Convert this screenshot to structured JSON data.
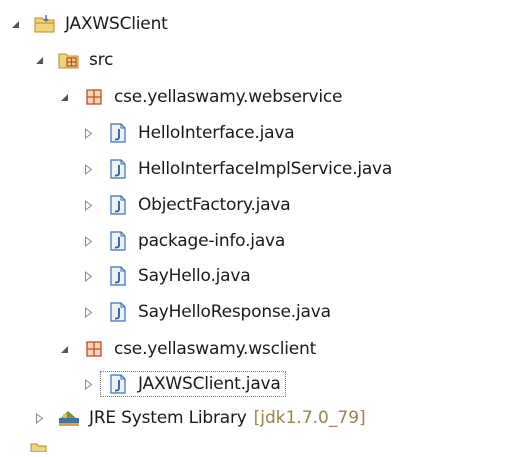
{
  "tree": {
    "project": {
      "label": "JAXWSClient"
    },
    "src_folder": {
      "label": "src"
    },
    "package_webservice": {
      "label": "cse.yellaswamy.webservice",
      "files": [
        "HelloInterface.java",
        "HelloInterfaceImplService.java",
        "ObjectFactory.java",
        "package-info.java",
        "SayHello.java",
        "SayHelloResponse.java"
      ]
    },
    "package_wsclient": {
      "label": "cse.yellaswamy.wsclient",
      "files": [
        "JAXWSClient.java"
      ]
    },
    "jre_library": {
      "label": "JRE System Library",
      "decoration": "[jdk1.7.0_79]"
    }
  },
  "colors": {
    "project_folder": "#e8c15a",
    "package": "#c24a2a",
    "java_file": "#3a6fb2",
    "library": "#3a6fa2",
    "decoration": "#96864a"
  },
  "icons": {
    "expanded_twisty": "filled-triangle-down-right",
    "collapsed_twisty": "hollow-triangle-right",
    "project": "project-folder-icon",
    "src": "source-folder-icon",
    "package": "package-icon",
    "java": "java-file-icon",
    "library": "library-icon"
  }
}
